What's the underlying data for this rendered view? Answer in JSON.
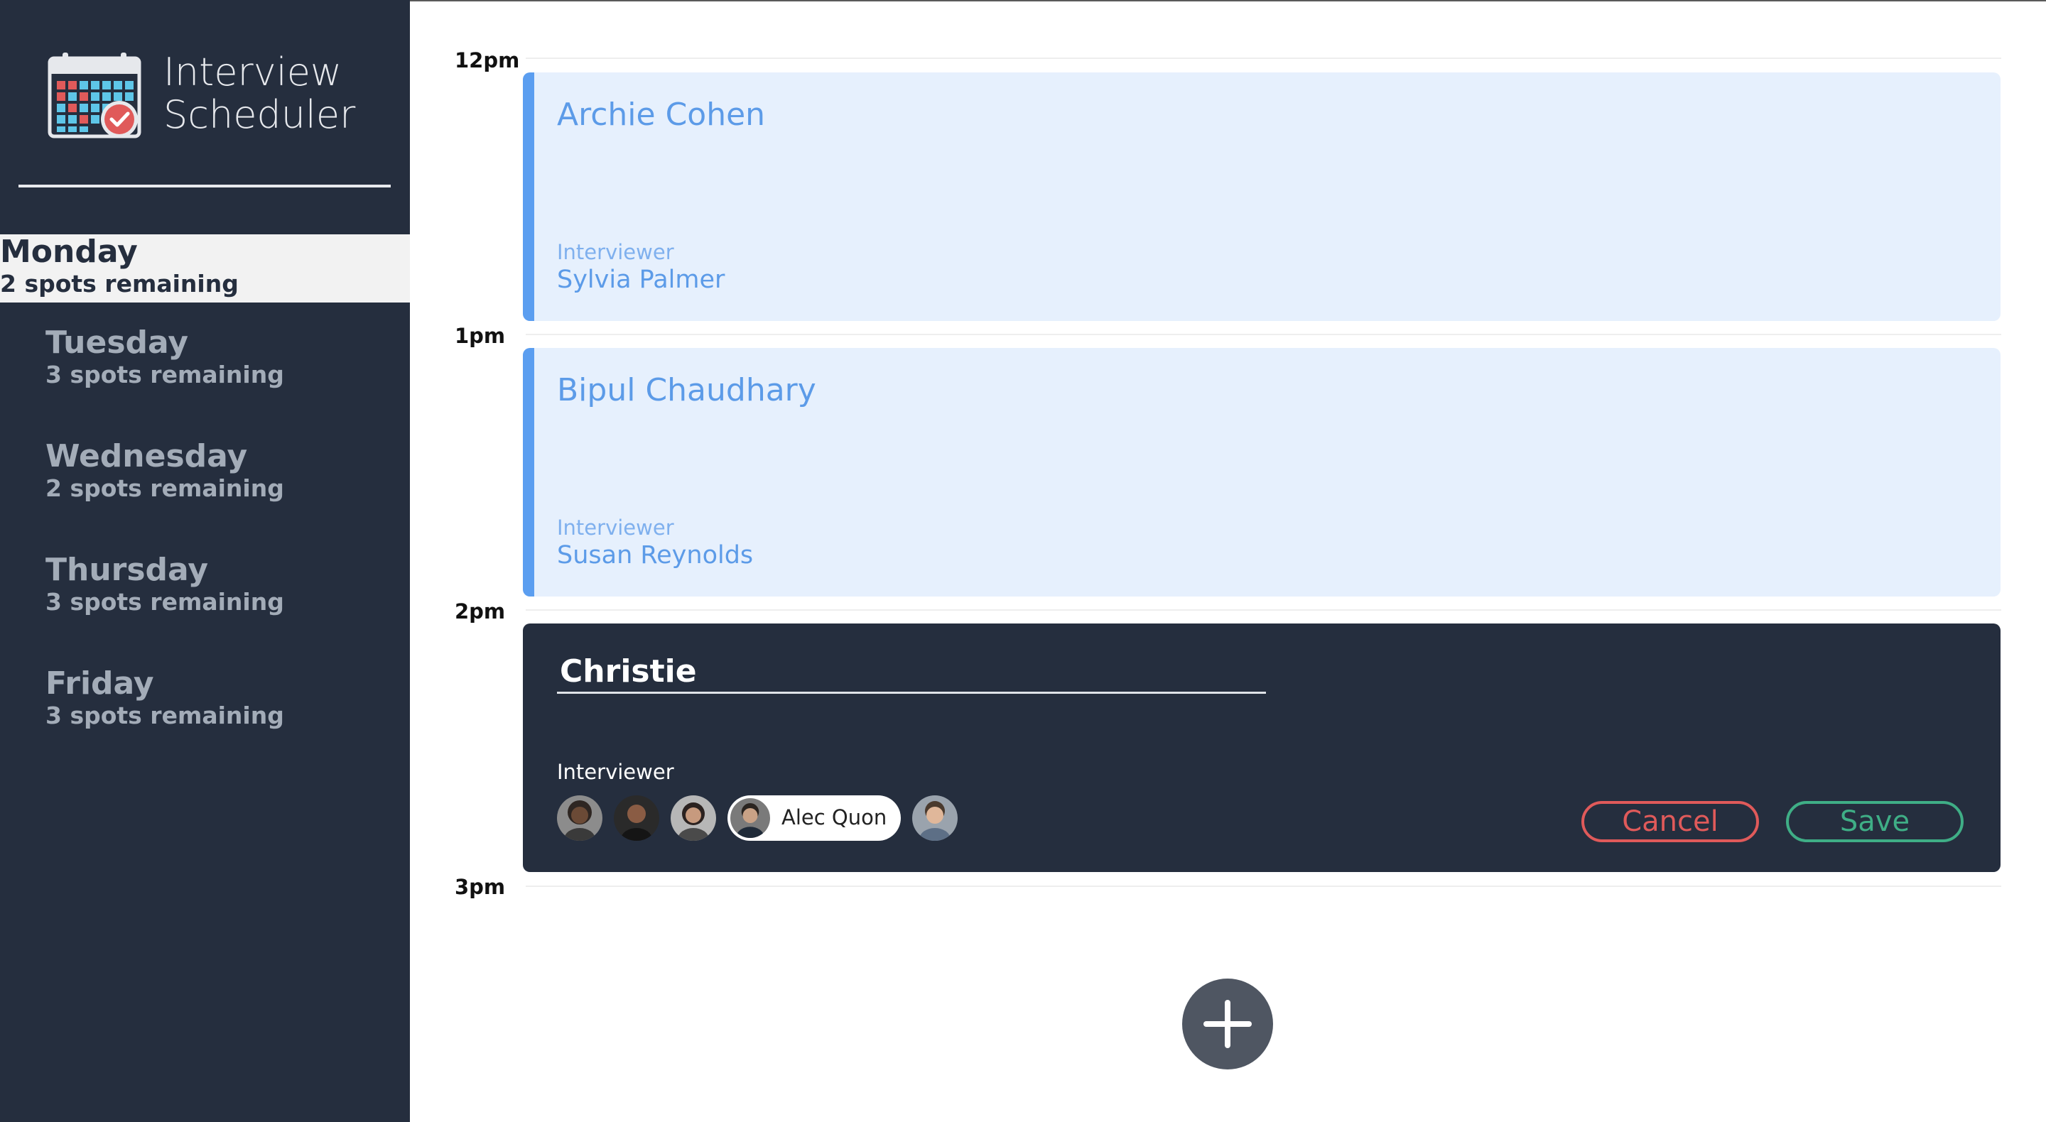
{
  "app": {
    "title_line1": "Interview",
    "title_line2": "Scheduler"
  },
  "sidebar": {
    "days": [
      {
        "name": "Monday",
        "spots": "2 spots remaining",
        "selected": true
      },
      {
        "name": "Tuesday",
        "spots": "3 spots remaining",
        "selected": false
      },
      {
        "name": "Wednesday",
        "spots": "2 spots remaining",
        "selected": false
      },
      {
        "name": "Thursday",
        "spots": "3 spots remaining",
        "selected": false
      },
      {
        "name": "Friday",
        "spots": "3 spots remaining",
        "selected": false
      }
    ]
  },
  "schedule": {
    "hours": [
      "12pm",
      "1pm",
      "2pm",
      "3pm"
    ],
    "appointments": [
      {
        "student": "Archie Cohen",
        "interviewer_label": "Interviewer",
        "interviewer": "Sylvia Palmer"
      },
      {
        "student": "Bipul Chaudhary",
        "interviewer_label": "Interviewer",
        "interviewer": "Susan Reynolds"
      }
    ],
    "form": {
      "student_value": "Christie",
      "interviewer_label": "Interviewer",
      "selected_interviewer": "Alec Quon",
      "cancel_label": "Cancel",
      "save_label": "Save"
    }
  },
  "colors": {
    "sidebar_bg": "#252e3e",
    "appointment_bg": "#e6f0fd",
    "appointment_accent": "#5b9ef0",
    "cancel": "#e05a5a",
    "save": "#3fae86",
    "add_button": "#4f5662"
  }
}
